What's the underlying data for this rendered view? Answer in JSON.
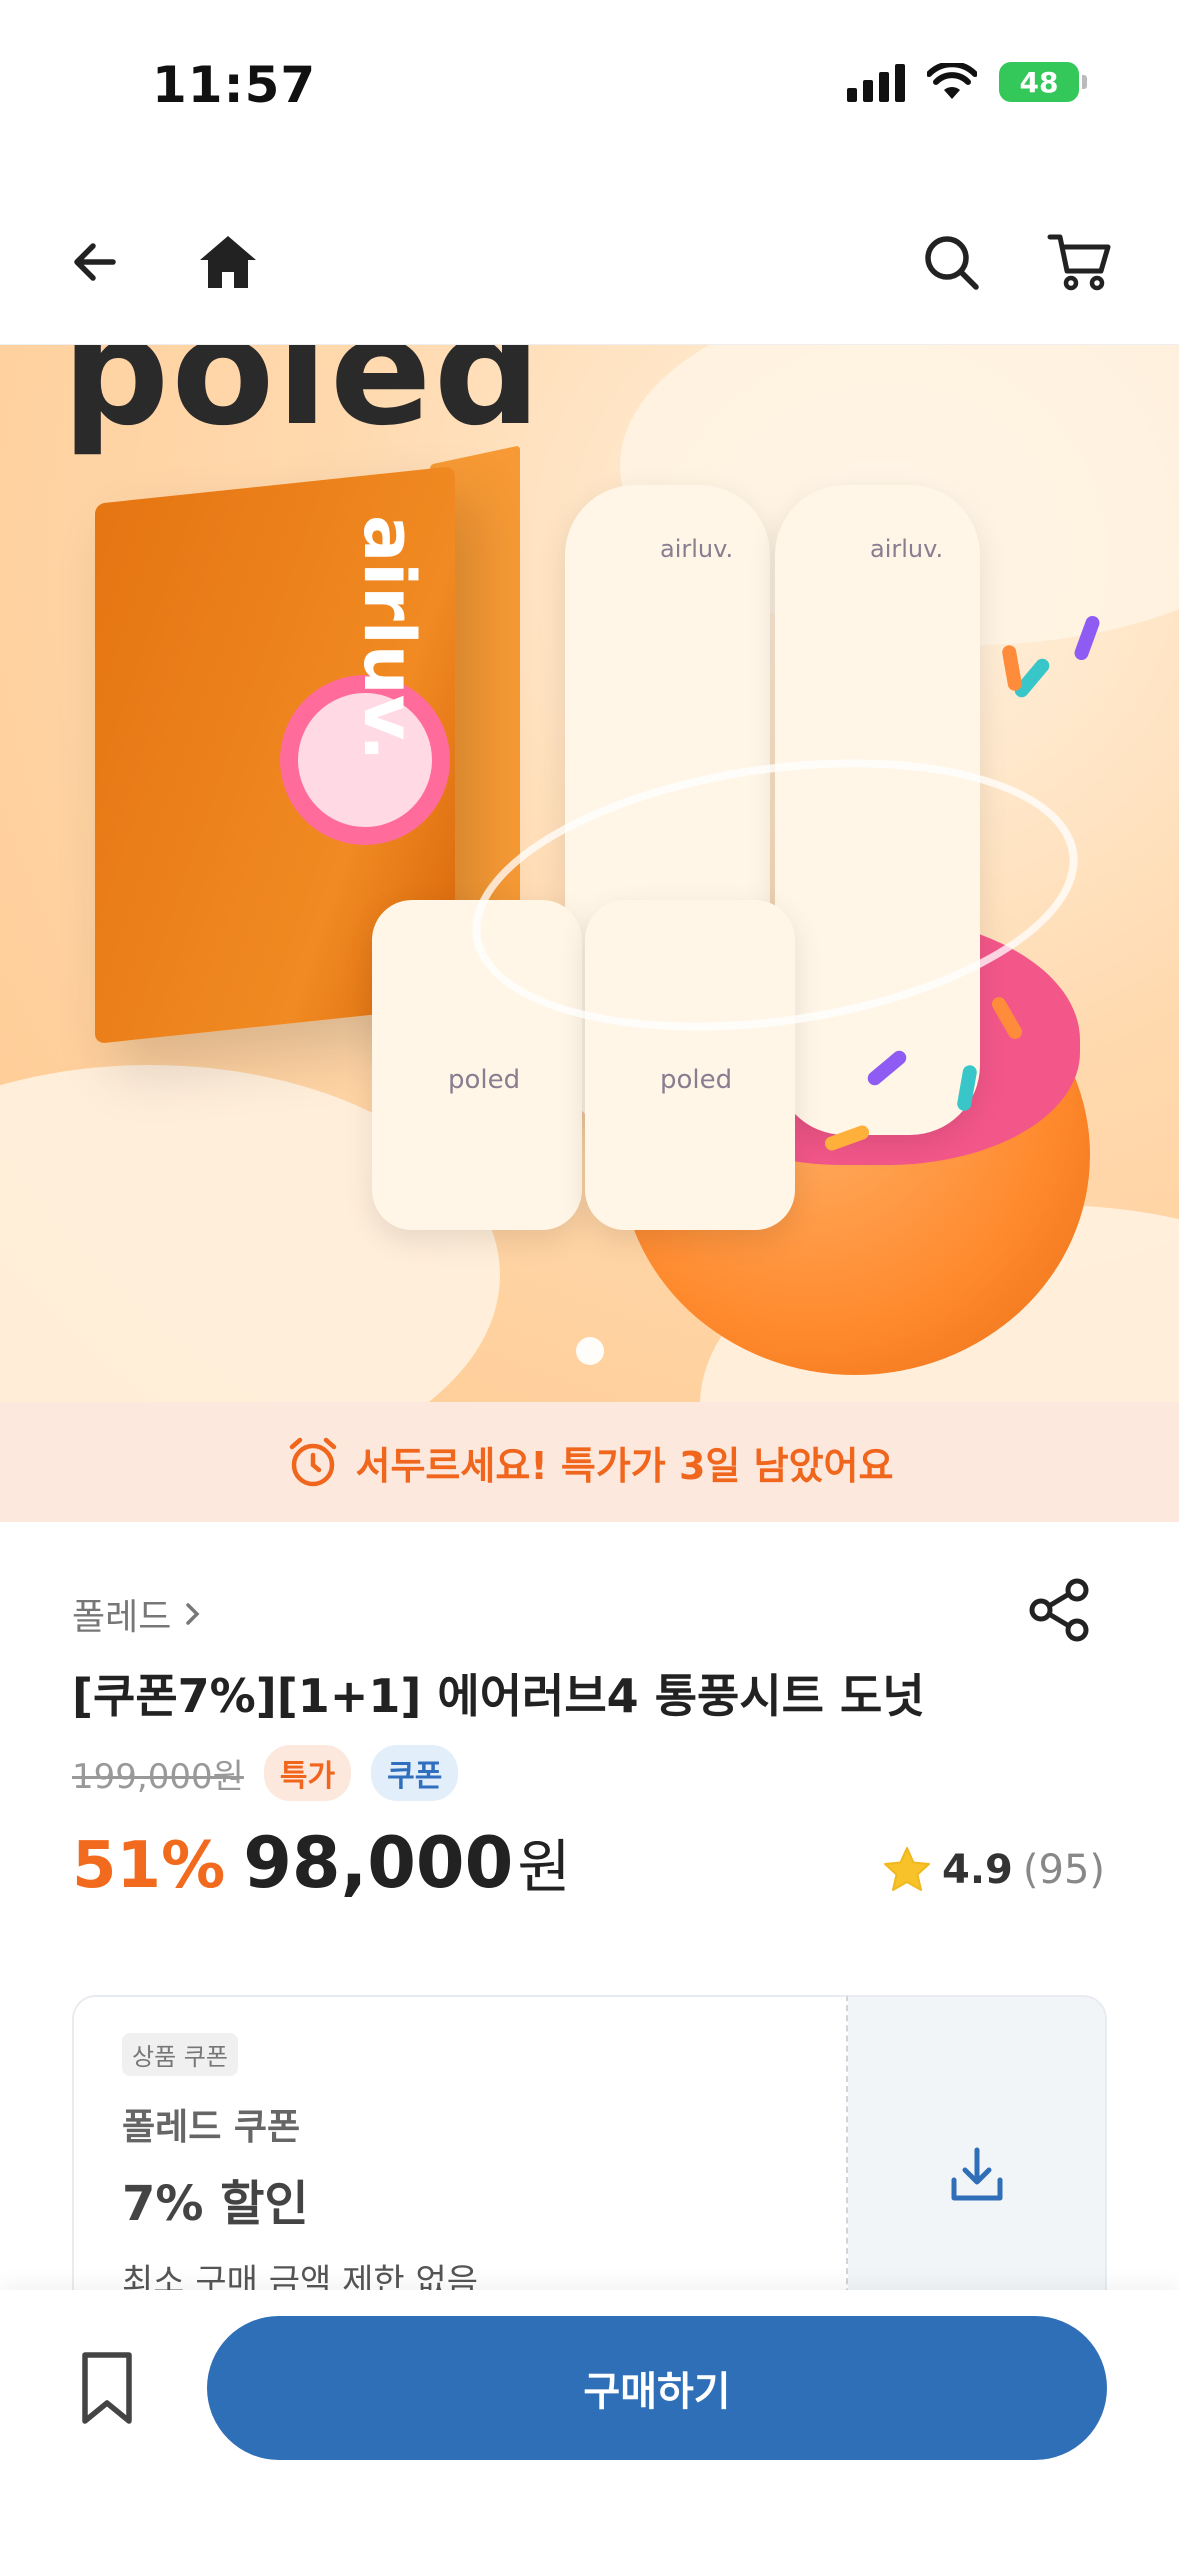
{
  "status_bar": {
    "time": "11:57",
    "battery": "48"
  },
  "nav": {
    "icons": [
      "back-arrow-icon",
      "home-icon",
      "search-icon",
      "cart-icon"
    ]
  },
  "hero": {
    "logo_text": "poled",
    "box_brand": "airluv.",
    "seat_brand": "airluv.",
    "pad_brand": "poled"
  },
  "promo": {
    "text": "서두르세요! 특가가 3일 남았어요",
    "color": "#f0661d"
  },
  "product": {
    "brand": "폴레드",
    "title": "[쿠폰7%][1+1] 에어러브4 통풍시트 도넛",
    "original_price": "199,000원",
    "badges": {
      "sale": "특가",
      "coupon": "쿠폰"
    },
    "discount": "51%",
    "price": "98,000",
    "currency": "원",
    "rating": "4.9",
    "review_count": "(95)"
  },
  "coupon": {
    "tag": "상품 쿠폰",
    "brand": "폴레드 쿠폰",
    "discount": "7% 할인",
    "condition": "최소 구매 금액 제한 없음"
  },
  "bottom": {
    "buy_label": "구매하기",
    "accent": "#2f6fb8"
  }
}
